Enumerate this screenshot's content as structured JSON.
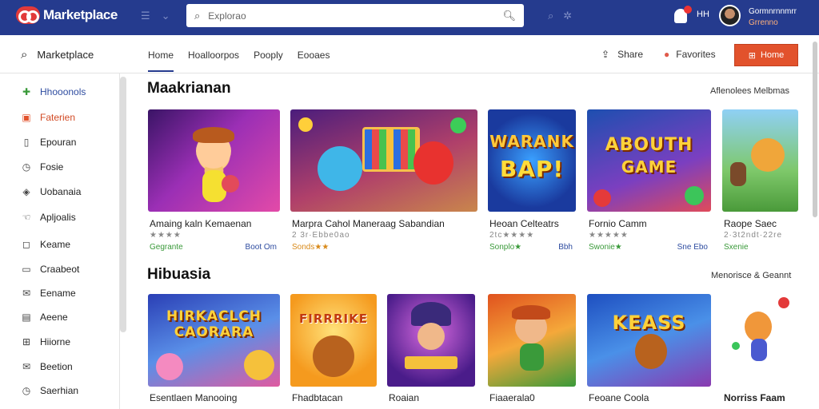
{
  "topbar": {
    "logo_text": "Marketplace",
    "search_placeholder": "Explorao",
    "notif_label": "HH",
    "user_name": "Gormnrnnmrr",
    "user_sub": "Grrenno"
  },
  "subbar": {
    "brand": "Marketplace",
    "tabs": [
      "Home",
      "Hoalloorpos",
      "Pooply",
      "Eooaes"
    ],
    "share": "Share",
    "favorites": "Favorites",
    "cta": "Home"
  },
  "sidebar": {
    "items": [
      {
        "label": "Hhooonols",
        "icon": "puzzle-icon"
      },
      {
        "label": "Faterien",
        "icon": "square-icon"
      },
      {
        "label": "Epouran",
        "icon": "page-icon"
      },
      {
        "label": "Fosie",
        "icon": "clock-icon"
      },
      {
        "label": "Uobanaia",
        "icon": "tag-icon"
      },
      {
        "label": "Apljoalis",
        "icon": "hand-icon"
      },
      {
        "label": "Keame",
        "icon": "chat-icon"
      },
      {
        "label": "Craabeot",
        "icon": "box-icon"
      },
      {
        "label": "Eename",
        "icon": "mail-icon"
      },
      {
        "label": "Aeene",
        "icon": "card-icon"
      },
      {
        "label": "Hiiorne",
        "icon": "grid-icon"
      },
      {
        "label": "Beetion",
        "icon": "mail-icon"
      },
      {
        "label": "Saerhian",
        "icon": "clock-icon"
      }
    ]
  },
  "section1": {
    "title": "Maakrianan",
    "link": "Aflenolees Melbmas",
    "cards": [
      {
        "title": "Amaing kaln Kemaenan",
        "meta": "★★★★",
        "foot_left": "Gegrante",
        "foot_right": "Boot Om"
      },
      {
        "title": "Marpra Cahol Maneraag Sabandian",
        "meta": "2 3r·Ebbe0ao",
        "foot_left": "Sonds★★",
        "foot_right": ""
      },
      {
        "title": "Heoan Celteatrs",
        "meta": "2tc★★★★",
        "foot_left": "Sonplo★",
        "foot_right": "Bbh"
      },
      {
        "title": "Fornio Camm",
        "meta": "★★★★★",
        "foot_left": "Swonie★",
        "foot_right": "Sne Ebo"
      },
      {
        "title": "Raope Saec",
        "meta": "2·3t2ndt·22re",
        "foot_left": "Sxenie",
        "foot_right": ""
      }
    ]
  },
  "section2": {
    "title": "Hibuasia",
    "link": "Menorisce & Geannt",
    "cards": [
      {
        "title": "Esentlaen Manooing",
        "art_text": "HIRKACLCH CAORARA"
      },
      {
        "title": "Fhadbtacan",
        "art_text": "FIRRRIKE"
      },
      {
        "title": "Roaian",
        "art_text": ""
      },
      {
        "title": "Fiaaerala0",
        "art_text": ""
      },
      {
        "title": "Feoane Coola",
        "art_text": "KEASS"
      },
      {
        "title": "Norriss Faam",
        "art_text": ""
      }
    ]
  },
  "art1": {
    "s1c3": "WARANK",
    "s1c3b": "BAP!",
    "s1c4": "ABOUTH",
    "s1c4b": "GAME"
  }
}
